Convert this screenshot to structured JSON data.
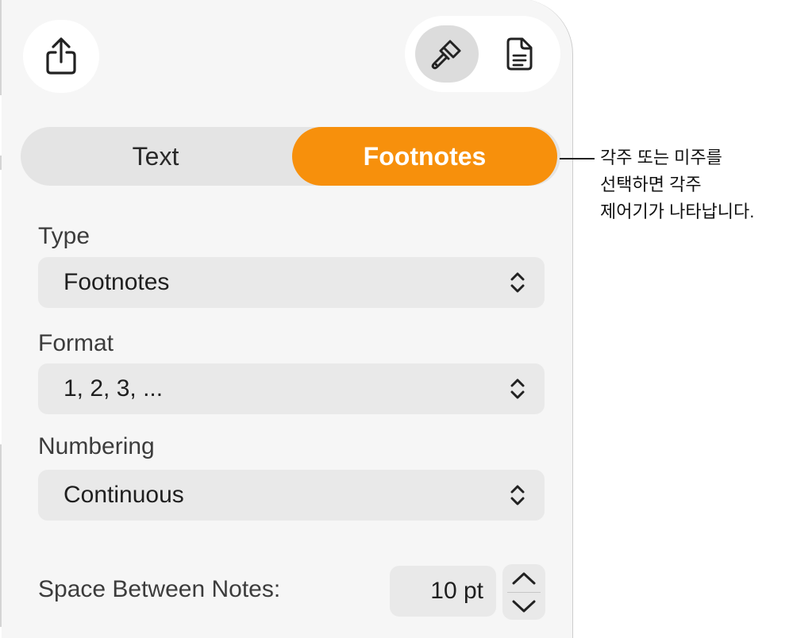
{
  "tabs": {
    "text_label": "Text",
    "footnotes_label": "Footnotes",
    "active": "Footnotes",
    "accent_color": "#f7900c"
  },
  "toolbar": {
    "share_icon": "share-icon",
    "format_icon": "paintbrush-icon",
    "document_icon": "document-icon"
  },
  "type": {
    "label": "Type",
    "value": "Footnotes"
  },
  "format": {
    "label": "Format",
    "value": "1, 2, 3, ..."
  },
  "numbering": {
    "label": "Numbering",
    "value": "Continuous"
  },
  "spacing": {
    "label": "Space Between Notes:",
    "value": "10 pt"
  },
  "callout": {
    "line1": "각주 또는 미주를",
    "line2": "선택하면 각주",
    "line3": "제어기가 나타납니다."
  }
}
